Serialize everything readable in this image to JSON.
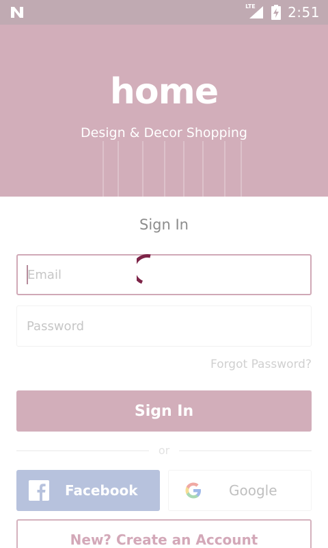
{
  "status_bar": {
    "carrier_icon": "n-icon",
    "network_label": "LTE",
    "time": "2:51"
  },
  "hero": {
    "logo": "home",
    "tagline": "Design & Decor Shopping"
  },
  "signin": {
    "title": "Sign In",
    "email_placeholder": "Email",
    "password_placeholder": "Password",
    "forgot_label": "Forgot Password?",
    "submit_label": "Sign In",
    "divider_label": "or"
  },
  "social": {
    "facebook_label": "Facebook",
    "google_label": "Google"
  },
  "footer": {
    "create_account_label": "New? Create an Account"
  },
  "colors": {
    "brand": "#d2aeba",
    "accent": "#7d2448",
    "facebook": "#b7c2dd"
  }
}
